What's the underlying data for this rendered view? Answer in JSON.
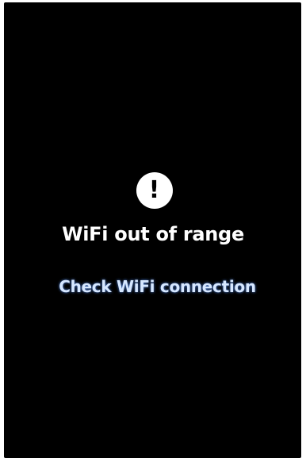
{
  "alert": {
    "icon": "exclamation-icon",
    "glyph": "!",
    "title": "WiFi out of range"
  },
  "action": {
    "label": "Check WiFi connection"
  },
  "colors": {
    "background": "#000000",
    "title": "#ffffff",
    "link": "#d6e7ff"
  }
}
